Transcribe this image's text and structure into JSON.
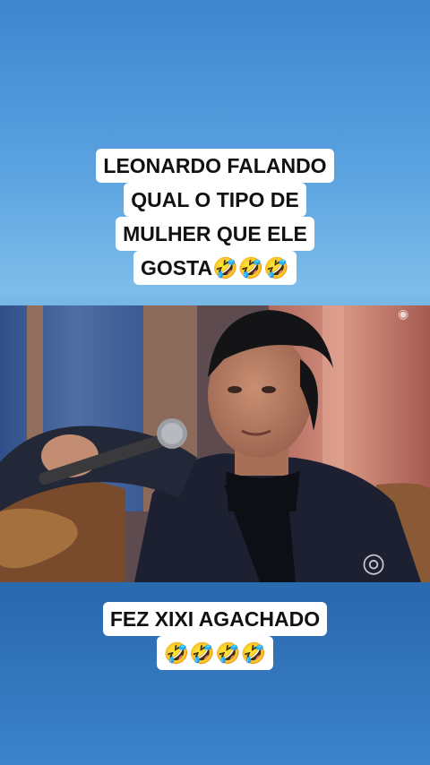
{
  "top_caption": {
    "lines": [
      "LEONARDO FALANDO",
      "QUAL O TIPO DE",
      "MULHER QUE ELE",
      "GOSTA🤣🤣🤣"
    ]
  },
  "video": {
    "watermark_icon": "tv-network-logo-icon"
  },
  "bottom_caption": {
    "lines": [
      "FEZ XIXI AGACHADO",
      "🤣🤣🤣🤣"
    ]
  },
  "colors": {
    "background_top": "#5aa2e0",
    "background_bottom": "#2a69ae",
    "caption_bg": "#ffffff",
    "caption_text": "#111111"
  }
}
